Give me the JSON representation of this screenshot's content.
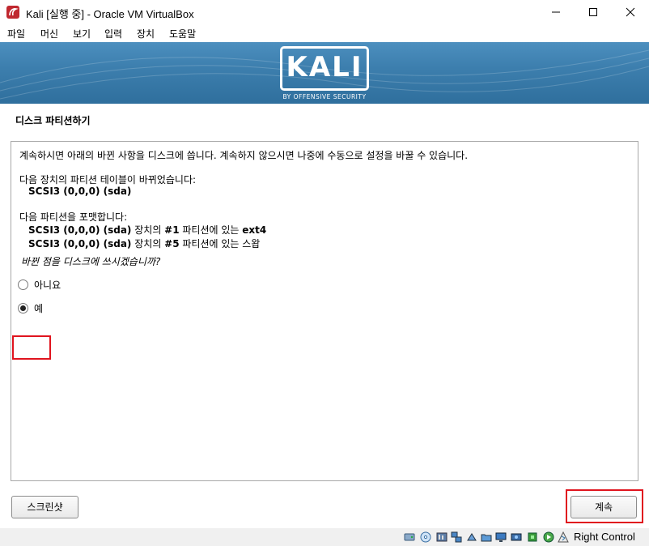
{
  "window": {
    "title": "Kali [실행 중] - Oracle VM VirtualBox",
    "controls": {
      "minimize": "—",
      "maximize": "☐",
      "close": "✕"
    }
  },
  "menu": [
    "파일",
    "머신",
    "보기",
    "입력",
    "장치",
    "도움말"
  ],
  "banner": {
    "logo": "KALI",
    "subtitle": "BY OFFENSIVE SECURITY"
  },
  "installer": {
    "section_title": "디스크 파티션하기",
    "intro": "계속하시면 아래의 바뀐 사항을 디스크에 씁니다. 계속하지 않으시면 나중에 수동으로 설정을 바꿀 수 있습니다.",
    "table_changed_label": "다음 장치의 파티션 테이블이 바뀌었습니다:",
    "table_changed_device": "SCSI3 (0,0,0) (sda)",
    "format_label": "다음 파티션을 포맷합니다:",
    "format_items": [
      {
        "device": "SCSI3 (0,0,0) (sda)",
        "mid": " 장치의 ",
        "part": "#1",
        "tail": " 파티션에 있는 ",
        "fs": "ext4"
      },
      {
        "device": "SCSI3 (0,0,0) (sda)",
        "mid": " 장치의 ",
        "part": "#5",
        "tail": " 파티션에 있는 ",
        "fs": "스왑"
      }
    ],
    "question": "바뀐 점을 디스크에 쓰시겠습니까?",
    "options": [
      {
        "label": "아니요",
        "selected": false
      },
      {
        "label": "예",
        "selected": true
      }
    ],
    "screenshot_button": "스크린샷",
    "continue_button": "계속"
  },
  "statusbar": {
    "host_key": "Right Control",
    "icons": [
      "hard-disk-icon",
      "optical-drive-icon",
      "audio-icon",
      "network-icon",
      "usb-icon",
      "shared-folder-icon",
      "display-icon",
      "video-capture-icon",
      "cpu-icon",
      "mouse-integration-icon",
      "keyboard-icon"
    ]
  },
  "colors": {
    "highlight": "#e0141e",
    "banner": "#3d7fae"
  }
}
